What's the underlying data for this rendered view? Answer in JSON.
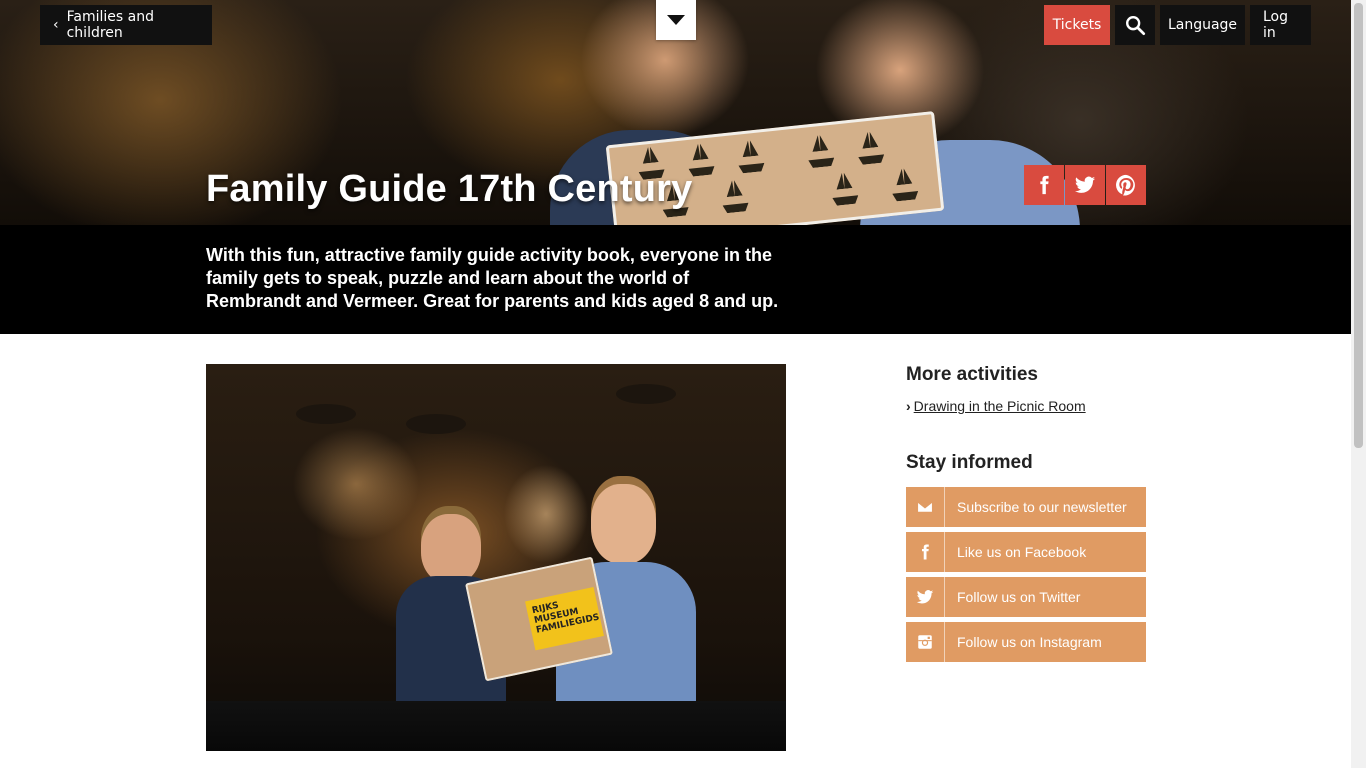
{
  "nav": {
    "back_label": "Families and children",
    "tickets_label": "Tickets",
    "language_label": "Language",
    "login_label": "Log in"
  },
  "hero": {
    "title": "Family Guide 17th Century"
  },
  "intro": {
    "text": "With this fun, attractive family guide activity book, everyone in the family gets to speak, puzzle and learn about the world of Rembrandt and Vermeer. Great for parents and kids aged 8 and up."
  },
  "photo": {
    "book_text": "RIJKS MUSEUM FAMILIEGIDS"
  },
  "sidebar": {
    "more_heading": "More activities",
    "more_links": [
      "Drawing in the Picnic Room"
    ],
    "stay_heading": "Stay informed",
    "social": [
      {
        "label": "Subscribe to our newsletter",
        "icon": "envelope-icon"
      },
      {
        "label": "Like us on Facebook",
        "icon": "facebook-icon"
      },
      {
        "label": "Follow us on Twitter",
        "icon": "twitter-icon"
      },
      {
        "label": "Follow us on Instagram",
        "icon": "instagram-icon"
      }
    ]
  },
  "colors": {
    "accent_red": "#d94b3f",
    "social_orange": "#e09b63",
    "intro_bg": "#000000"
  }
}
